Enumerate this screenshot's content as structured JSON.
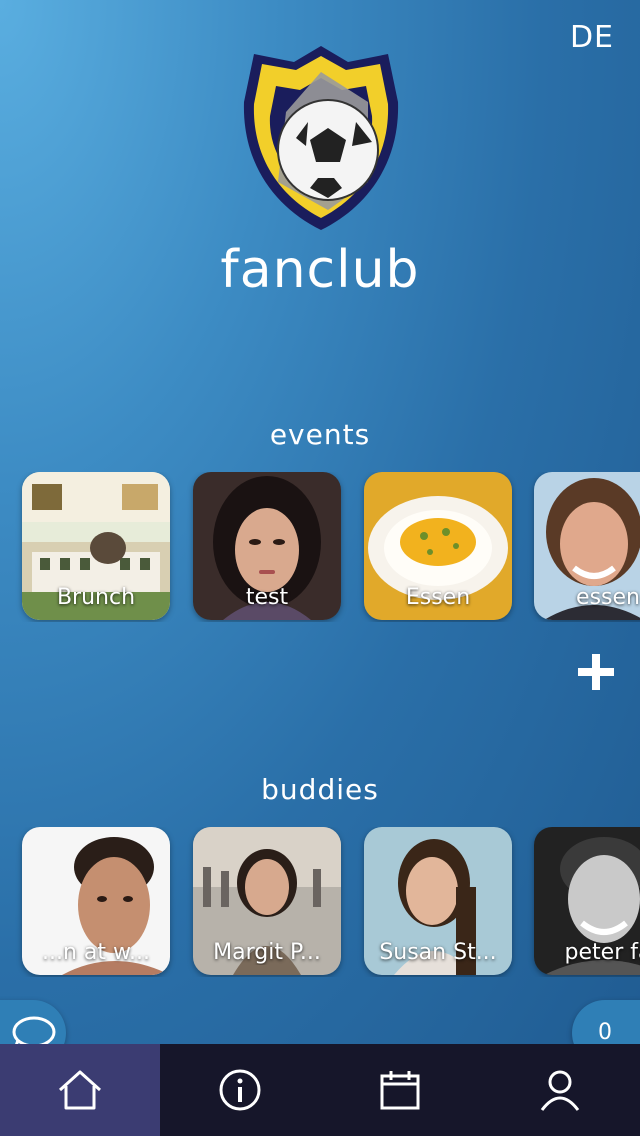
{
  "header": {
    "language": "DE",
    "brand": "fanclub"
  },
  "events": {
    "title": "events",
    "items": [
      {
        "label": "Brunch"
      },
      {
        "label": "test"
      },
      {
        "label": "Essen"
      },
      {
        "label": "essen"
      }
    ]
  },
  "buddies": {
    "title": "buddies",
    "items": [
      {
        "label": "...n at w..."
      },
      {
        "label": "Margit P..."
      },
      {
        "label": "Susan St..."
      },
      {
        "label": "peter fa"
      }
    ]
  },
  "chat": {
    "count": "0"
  },
  "tabs": [
    {
      "icon": "home-icon",
      "active": true
    },
    {
      "icon": "info-icon",
      "active": false
    },
    {
      "icon": "calendar-icon",
      "active": false
    },
    {
      "icon": "user-icon",
      "active": false
    }
  ],
  "colors": {
    "tab_active": "#3b3c72",
    "tab_bar": "#16162a",
    "badge_yellow": "#f2cf2a",
    "badge_navy": "#1a1d5c"
  }
}
